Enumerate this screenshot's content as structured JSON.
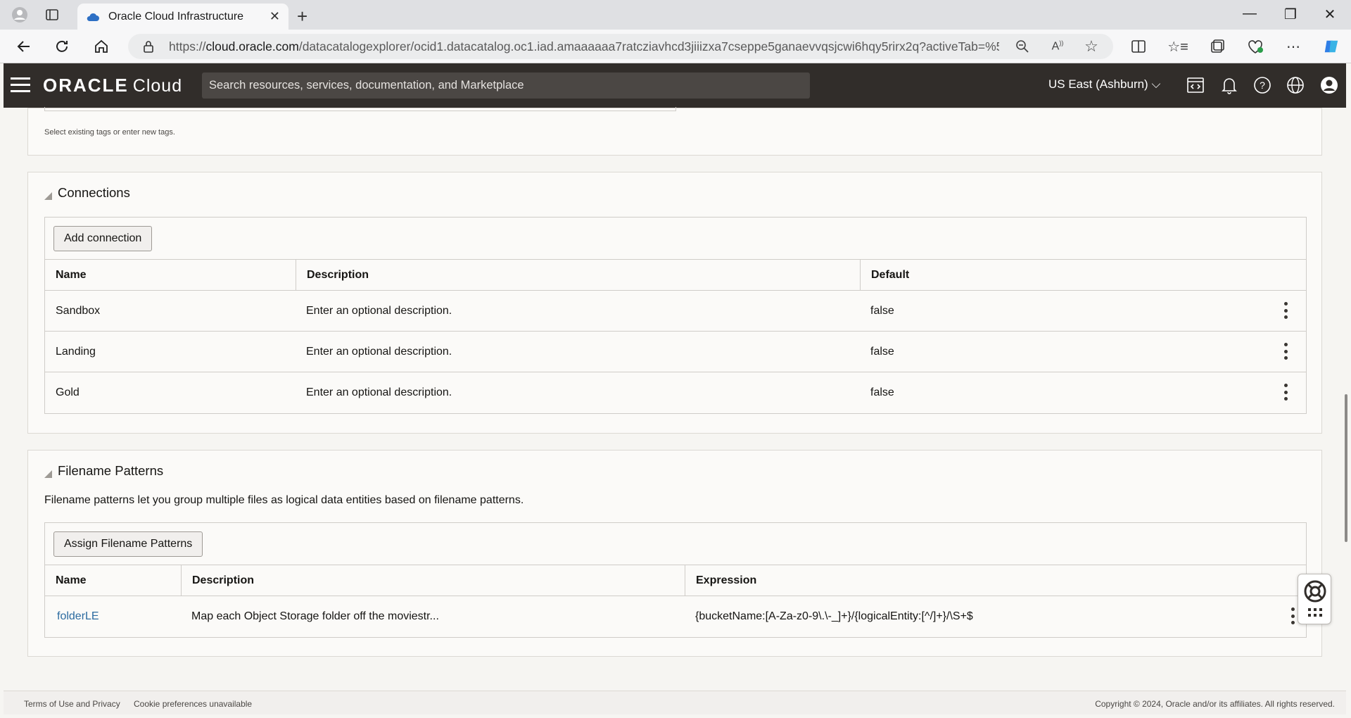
{
  "browser": {
    "tab_title": "Oracle Cloud Infrastructure",
    "url_prefix": "https://",
    "url_domain": "cloud.oracle.com",
    "url_rest": "/datacatalogexplorer/ocid1.datacatalog.oc1.iad.amaaaaaa7ratcziavhcd3jiiizxa7cseppe5ganaevvqsjcwi6hqy5rirx2q?activeTab=%5..."
  },
  "header": {
    "logo_oracle": "ORACLE",
    "logo_cloud": "Cloud",
    "search_placeholder": "Search resources, services, documentation, and Marketplace",
    "region": "US East (Ashburn)"
  },
  "tags": {
    "help_text": "Select existing tags or enter new tags."
  },
  "connections": {
    "title": "Connections",
    "add_button": "Add connection",
    "columns": [
      "Name",
      "Description",
      "Default"
    ],
    "rows": [
      {
        "name": "Sandbox",
        "description": "Enter an optional description.",
        "default": "false"
      },
      {
        "name": "Landing",
        "description": "Enter an optional description.",
        "default": "false"
      },
      {
        "name": "Gold",
        "description": "Enter an optional description.",
        "default": "false"
      }
    ]
  },
  "filename_patterns": {
    "title": "Filename Patterns",
    "description": "Filename patterns let you group multiple files as logical data entities based on filename patterns.",
    "assign_button": "Assign Filename Patterns",
    "columns": [
      "Name",
      "Description",
      "Expression"
    ],
    "rows": [
      {
        "name": "folderLE",
        "description": "Map each Object Storage folder off the moviestr...",
        "expression": "{bucketName:[A-Za-z0-9\\.\\-_]+}/{logicalEntity:[^/]+}/\\S+$"
      }
    ]
  },
  "footer": {
    "terms": "Terms of Use and Privacy",
    "cookies": "Cookie preferences unavailable",
    "copyright": "Copyright © 2024, Oracle and/or its affiliates. All rights reserved."
  },
  "colors": {
    "header_bg": "#312d2a",
    "link": "#2c6ba0",
    "page_bg": "#f6f5f2"
  }
}
